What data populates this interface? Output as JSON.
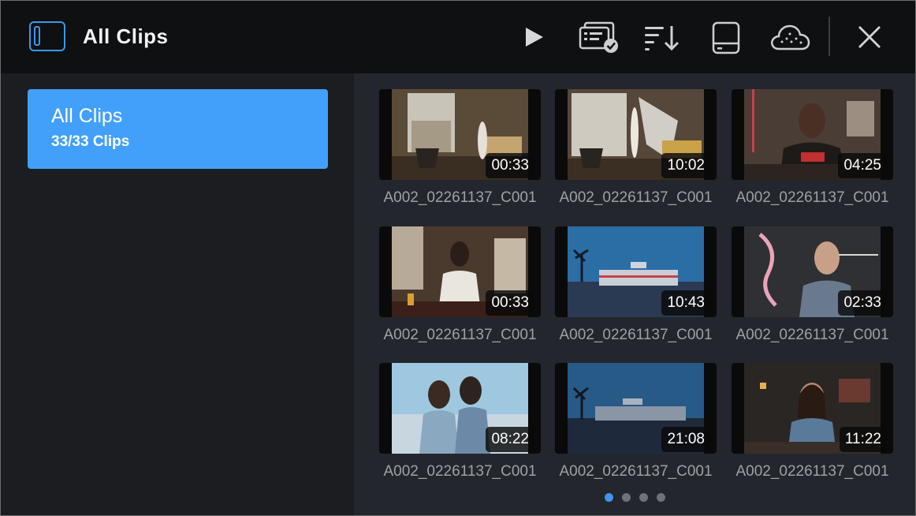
{
  "header": {
    "title": "All Clips",
    "icons": [
      "sidebar-toggle-icon",
      "play-icon",
      "clips-selected-icon",
      "sort-icon",
      "storage-icon",
      "cloud-icon",
      "close-icon"
    ],
    "accent": "#3f95f0"
  },
  "sidebar": {
    "albums": [
      {
        "name": "All Clips",
        "count": "33/33 Clips",
        "selected": true
      }
    ],
    "selected_color": "#42a0fb"
  },
  "clips": [
    {
      "name": "A002_02261137_C001",
      "duration": "00:33"
    },
    {
      "name": "A002_02261137_C001",
      "duration": "10:02"
    },
    {
      "name": "A002_02261137_C001",
      "duration": "04:25"
    },
    {
      "name": "A002_02261137_C001",
      "duration": "00:33"
    },
    {
      "name": "A002_02261137_C001",
      "duration": "10:43"
    },
    {
      "name": "A002_02261137_C001",
      "duration": "02:33"
    },
    {
      "name": "A002_02261137_C001",
      "duration": "08:22"
    },
    {
      "name": "A002_02261137_C001",
      "duration": "21:08"
    },
    {
      "name": "A002_02261137_C001",
      "duration": "11:22"
    }
  ],
  "pagination": {
    "pages": 4,
    "current": 1
  }
}
